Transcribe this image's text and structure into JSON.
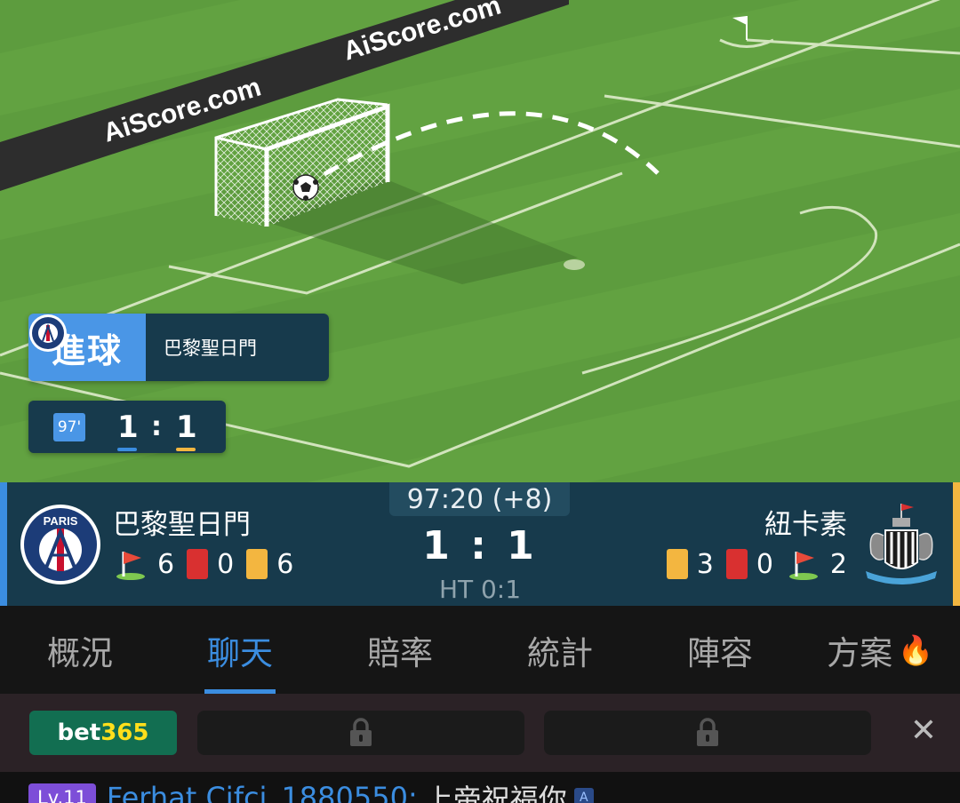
{
  "pitch": {
    "ad_boards": [
      "AiScore.com",
      "AiScore.com"
    ]
  },
  "event": {
    "type_label": "進球",
    "team_name": "巴黎聖日門"
  },
  "mini_score": {
    "minute": "97'",
    "home": "1",
    "away": "1",
    "separator": ":"
  },
  "match": {
    "clock": "97:20 (+8)",
    "score": "1 : 1",
    "halftime": "HT 0:1",
    "home": {
      "name": "巴黎聖日門",
      "crest_text": "PARIS",
      "corners": "6",
      "red_cards": "0",
      "yellow_cards": "6",
      "color": "#3b8de0"
    },
    "away": {
      "name": "紐卡素",
      "yellow_cards": "3",
      "red_cards": "0",
      "corners": "2",
      "color": "#f3b640"
    }
  },
  "tabs": [
    {
      "label": "概況"
    },
    {
      "label": "聊天"
    },
    {
      "label": "賠率"
    },
    {
      "label": "統計"
    },
    {
      "label": "陣容"
    },
    {
      "label": "方案"
    }
  ],
  "active_tab": "聊天",
  "betting": {
    "brand_part1": "bet",
    "brand_part2": "365",
    "slot_icon": "lock-icon",
    "close_label": "✕"
  },
  "chat": {
    "level": "Lv.11",
    "user": "Ferhat Cifci_1880550:",
    "message": "上帝祝福你",
    "translate_badge": "A"
  }
}
